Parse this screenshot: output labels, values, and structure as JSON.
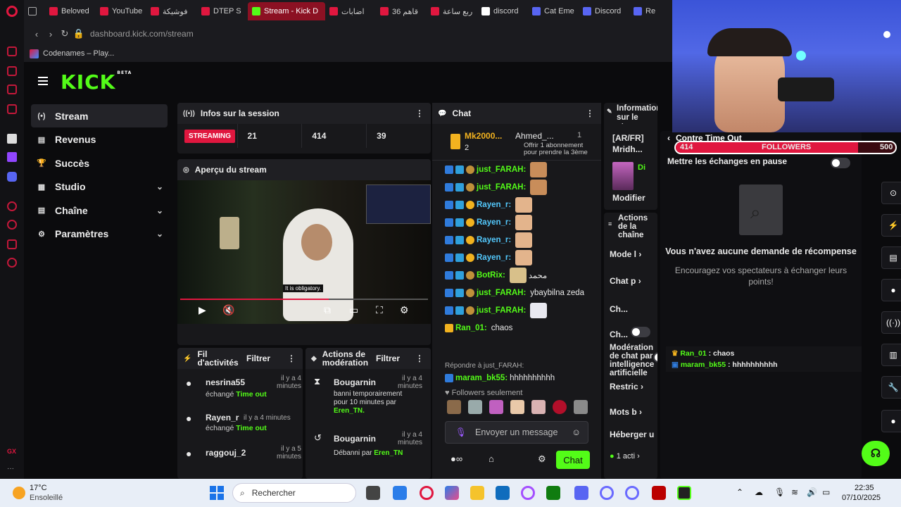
{
  "browser": {
    "tabs": [
      {
        "label": "Beloved",
        "color": "#e0173f"
      },
      {
        "label": "YouTube",
        "color": "#e0173f"
      },
      {
        "label": "فوشيكة",
        "color": "#e0173f"
      },
      {
        "label": "DTEP S",
        "color": "#e0173f"
      },
      {
        "label": "Stream - Kick D",
        "color": "#53fc18",
        "active": true
      },
      {
        "label": "اضابات",
        "color": "#e0173f"
      },
      {
        "label": "قاهم 36",
        "color": "#e0173f"
      },
      {
        "label": "ربع ساعة",
        "color": "#e0173f"
      },
      {
        "label": "discord",
        "color": "#ffffff"
      },
      {
        "label": "Cat Eme",
        "color": "#5865f2"
      },
      {
        "label": "Discord",
        "color": "#5865f2"
      },
      {
        "label": "Re",
        "color": "#5865f2"
      }
    ],
    "url": "dashboard.kick.com/stream",
    "bookmark": "Codenames – Play..."
  },
  "kick": {
    "logo": "KICK",
    "logo_badge": "BETA",
    "sidebar": [
      {
        "label": "Stream",
        "icon": "(•)",
        "active": true,
        "chevron": false
      },
      {
        "label": "Revenus",
        "icon": "▤",
        "chevron": false
      },
      {
        "label": "Succès",
        "icon": "🏆",
        "chevron": false
      },
      {
        "label": "Studio",
        "icon": "▦",
        "chevron": true
      },
      {
        "label": "Chaîne",
        "icon": "▤",
        "chevron": true
      },
      {
        "label": "Paramètres",
        "icon": "⚙",
        "chevron": true
      }
    ],
    "session": {
      "title": "Infos sur la session",
      "status": "STREAMING",
      "stats": [
        "21",
        "414",
        "39"
      ]
    },
    "preview": {
      "title": "Aperçu du stream",
      "subtitle": "It is obligatory."
    },
    "activity": {
      "title": "Fil d'activités",
      "filter": "Filtrer",
      "items": [
        {
          "user": "nesrina55",
          "time": "il y a 4 minutes",
          "action": "échangé",
          "reward": "Time out"
        },
        {
          "user": "Rayen_r",
          "time": "il y a 4 minutes",
          "action": "échangé",
          "reward": "Time out"
        },
        {
          "user": "raggouj_2",
          "time": "il y a 5 minutes",
          "action": "",
          "reward": ""
        }
      ]
    },
    "moderation": {
      "title": "Actions de modération",
      "filter": "Filtrer",
      "items": [
        {
          "user": "Bougarnin",
          "time": "il y a 4 minutes",
          "text": "banni temporairement pour 10 minutes par",
          "by": "Eren_TN."
        },
        {
          "user": "Bougarnin",
          "time": "il y a 4 minutes",
          "text": "Débanni par",
          "by": "Eren_TN"
        }
      ]
    },
    "chat": {
      "title": "Chat",
      "top_user": "Mk2000...",
      "top_count": "2",
      "gift_user": "Ahmed_...",
      "gift_count": "1",
      "gift_text": "Offrir 1 abonnement pour prendre la 3ème",
      "messages": [
        {
          "user": "just_FARAH:",
          "color": "#53fc18",
          "text": "",
          "emote": true
        },
        {
          "user": "just_FARAH:",
          "color": "#53fc18",
          "text": "",
          "emote": true
        },
        {
          "user": "Rayen_r:",
          "color": "#53c8fc",
          "text": "",
          "emote": true
        },
        {
          "user": "Rayen_r:",
          "color": "#53c8fc",
          "text": "",
          "emote": true
        },
        {
          "user": "Rayen_r:",
          "color": "#53c8fc",
          "text": "",
          "emote": true
        },
        {
          "user": "Rayen_r:",
          "color": "#53c8fc",
          "text": "",
          "emote": true
        },
        {
          "user": "BotRix:",
          "color": "#53fc18",
          "text": "محمد",
          "emote": true
        },
        {
          "user": "just_FARAH:",
          "color": "#53fc18",
          "text": "ybaybilna zeda",
          "emote": false
        },
        {
          "user": "just_FARAH:",
          "color": "#53fc18",
          "text": "",
          "emote": true
        },
        {
          "user": "Ran_01:",
          "color": "#53fc18",
          "text": "chaos",
          "emote": false
        }
      ],
      "reply_hint": "Répondre à just_FARAH:",
      "last_user": "maram_bk55:",
      "last_text": "hhhhhhhhhh",
      "followers_only": "Followers seulement",
      "placeholder": "Envoyer un message",
      "send": "Chat"
    },
    "info": {
      "title": "Informations sur le stream",
      "stream_title": "[AR/FR] Mridh...",
      "modify": "Modifier"
    },
    "channel_actions": {
      "title": "Actions de la chaîne",
      "items": [
        "Mode l",
        "Chat p",
        "Ch...",
        "Ch...",
        "Modération de chat par intelligence artificielle",
        "Restric",
        "Mots b",
        "Héberger u",
        "1 acti"
      ]
    },
    "rewards": {
      "header": "Contre Time Out",
      "pause_label": "Mettre les échanges en pause",
      "empty_title": "Vous n'avez aucune demande de récompense",
      "empty_text": "Encouragez vos spectateurs à échanger leurs points!",
      "overlay_lines": [
        {
          "user": "Ran_01",
          "text": "chaos"
        },
        {
          "user": "maram_bk55",
          "text": "hhhhhhhhhh"
        }
      ]
    },
    "follower_goal": {
      "current": "414",
      "label": "FOLLOWERS",
      "target": "500",
      "progress": 0.83
    }
  },
  "taskbar": {
    "weather_temp": "17°C",
    "weather_text": "Ensoleillé",
    "search": "Rechercher",
    "time": "22:35",
    "date": "07/10/2025"
  }
}
